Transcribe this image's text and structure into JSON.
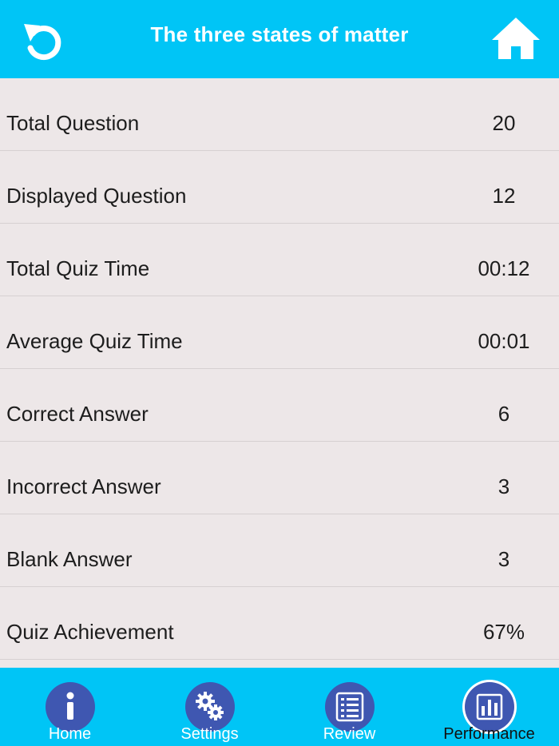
{
  "header": {
    "title": "The three states of matter",
    "back_icon": "undo-arrow-icon",
    "home_icon": "home-icon"
  },
  "stats": [
    {
      "label": "Total Question",
      "value": "20"
    },
    {
      "label": "Displayed Question",
      "value": "12"
    },
    {
      "label": "Total Quiz Time",
      "value": "00:12"
    },
    {
      "label": "Average Quiz Time",
      "value": "00:01"
    },
    {
      "label": "Correct Answer",
      "value": "6"
    },
    {
      "label": "Incorrect Answer",
      "value": "3"
    },
    {
      "label": "Blank Answer",
      "value": "3"
    },
    {
      "label": "Quiz Achievement",
      "value": "67%"
    }
  ],
  "tabs": [
    {
      "label": "Home",
      "icon": "info-icon"
    },
    {
      "label": "Settings",
      "icon": "gears-icon"
    },
    {
      "label": "Review",
      "icon": "checklist-icon"
    },
    {
      "label": "Performance",
      "icon": "bar-chart-icon",
      "active": true
    }
  ],
  "colors": {
    "accent": "#00c5f6",
    "tab_icon_bg": "#3f57b1",
    "background": "#ede7e8"
  }
}
